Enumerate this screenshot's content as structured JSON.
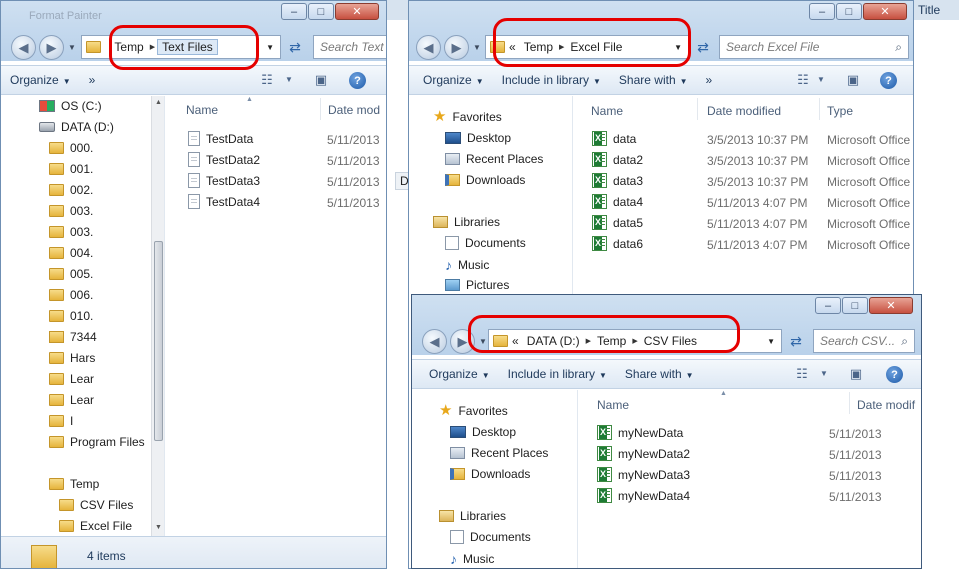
{
  "win_left": {
    "title": "Format Painter",
    "address": [
      "Temp",
      "Text Files"
    ],
    "search_placeholder": "Search Text",
    "toolbar": {
      "organize": "Organize",
      "more": "»"
    },
    "nav_tree": [
      "OS (C:)",
      "DATA (D:)",
      "000.",
      "001.",
      "002.",
      "003.",
      "003.",
      "004.",
      "005.",
      "006.",
      "010.",
      "7344",
      "Hars",
      "Lear",
      "Lear",
      "I",
      "Program Files",
      "Temp",
      "CSV Files",
      "Excel File"
    ],
    "columns": {
      "name": "Name",
      "date": "Date mod"
    },
    "files": [
      {
        "name": "TestData",
        "date": "5/11/2013"
      },
      {
        "name": "TestData2",
        "date": "5/11/2013"
      },
      {
        "name": "TestData3",
        "date": "5/11/2013"
      },
      {
        "name": "TestData4",
        "date": "5/11/2013"
      }
    ],
    "status": "4 items"
  },
  "win_excel": {
    "address": [
      "«",
      "Temp",
      "Excel File"
    ],
    "search_placeholder": "Search Excel File",
    "toolbar": {
      "organize": "Organize",
      "include": "Include in library",
      "share": "Share with",
      "more": "»"
    },
    "nav": {
      "favorites": "Favorites",
      "desktop": "Desktop",
      "recent": "Recent Places",
      "downloads": "Downloads",
      "libraries": "Libraries",
      "documents": "Documents",
      "music": "Music",
      "pictures": "Pictures"
    },
    "columns": {
      "name": "Name",
      "date": "Date modified",
      "type": "Type"
    },
    "files": [
      {
        "name": "data",
        "date": "3/5/2013 10:37 PM",
        "type": "Microsoft Office"
      },
      {
        "name": "data2",
        "date": "3/5/2013 10:37 PM",
        "type": "Microsoft Office"
      },
      {
        "name": "data3",
        "date": "3/5/2013 10:37 PM",
        "type": "Microsoft Office"
      },
      {
        "name": "data4",
        "date": "5/11/2013 4:07 PM",
        "type": "Microsoft Office"
      },
      {
        "name": "data5",
        "date": "5/11/2013 4:07 PM",
        "type": "Microsoft Office"
      },
      {
        "name": "data6",
        "date": "5/11/2013 4:07 PM",
        "type": "Microsoft Office"
      }
    ]
  },
  "win_csv": {
    "address": [
      "«",
      "DATA (D:)",
      "Temp",
      "CSV Files"
    ],
    "search_placeholder": "Search CSV...",
    "toolbar": {
      "organize": "Organize",
      "include": "Include in library",
      "share": "Share with"
    },
    "nav": {
      "favorites": "Favorites",
      "desktop": "Desktop",
      "recent": "Recent Places",
      "downloads": "Downloads",
      "libraries": "Libraries",
      "documents": "Documents",
      "music": "Music"
    },
    "columns": {
      "name": "Name",
      "date": "Date modif"
    },
    "files": [
      {
        "name": "myNewData",
        "date": "5/11/2013"
      },
      {
        "name": "myNewData2",
        "date": "5/11/2013"
      },
      {
        "name": "myNewData3",
        "date": "5/11/2013"
      },
      {
        "name": "myNewData4",
        "date": "5/11/2013"
      }
    ]
  },
  "background": {
    "title_fragment": "Title",
    "taskbar_fragment": "D"
  },
  "icons": {
    "back": "back-arrow-icon",
    "forward": "forward-arrow-icon",
    "refresh": "refresh-icon",
    "search": "search-icon",
    "help": "help-icon",
    "views": "views-icon",
    "preview": "preview-pane-icon",
    "folder": "folder-icon",
    "text_file": "text-file-icon",
    "excel_file": "excel-file-icon"
  },
  "colors": {
    "highlight": "#e50000",
    "frame": "#b9d1ea",
    "link": "#1e395b"
  }
}
